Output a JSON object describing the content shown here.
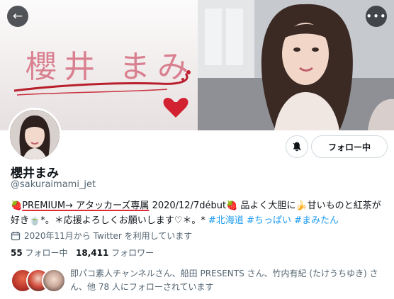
{
  "banner": {
    "name_art_text": "櫻井 まみ"
  },
  "profile": {
    "display_name": "櫻井まみ",
    "handle": "@sakuraimami_jet",
    "bio": {
      "strawberry1": "🍓",
      "premium": "PREMIUM→",
      "attackers": " アタッカーズ専属",
      "debut": " 2020/12/7début",
      "strawberry2": "🍓",
      "text1": " 品よく大胆に",
      "banana": "🍌",
      "text2": "甘いものと紅茶が好き",
      "cup": "🍵",
      "text3": "*。＊応援よろしくお願いします♡＊。*",
      "tags": [
        "#北海道",
        "#ちっぱい",
        "#まみたん"
      ]
    },
    "joined": "2020年11月から Twitter を利用しています",
    "following_count": "55",
    "following_label": "フォロー中",
    "followers_count": "18,411",
    "followers_label": "フォロワー",
    "followed_by": "即パコ素人チャンネルさん、船田 PRESENTS さん、竹内有紀 (たけうちゆき) さん、他 78 人にフォローされています"
  },
  "actions": {
    "follow_label": "フォロー中"
  },
  "icons": {
    "back": "back-arrow-icon",
    "more": "more-dots-icon",
    "notify": "bell-icon",
    "calendar": "calendar-icon"
  },
  "colors": {
    "link": "#1d9bf0",
    "secondary_text": "#536471",
    "banner_text": "#d98090",
    "accent_red": "#e0283c"
  }
}
